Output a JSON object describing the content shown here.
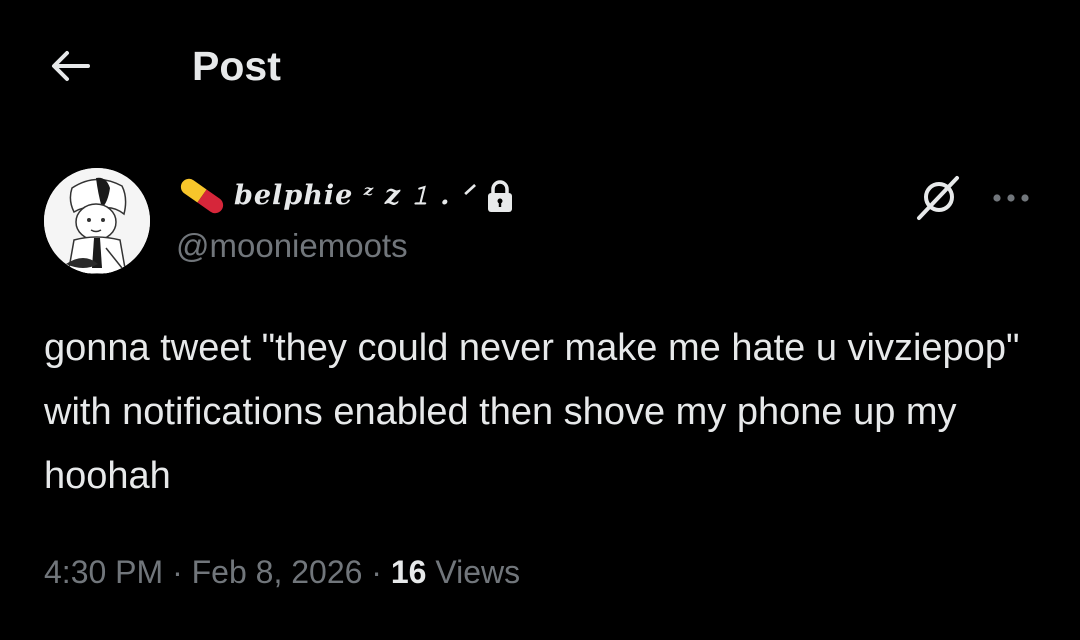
{
  "header": {
    "title": "Post",
    "back_icon": "arrow-left-icon"
  },
  "author": {
    "display_name": "belphie ᶻ z 𝟷 . ᐟ",
    "handle": "@mooniemoots",
    "avatar_icon": "avatar-image",
    "name_emoji": "pill-icon",
    "protected_icon": "lock-icon"
  },
  "actions": {
    "grok_icon": "grok-icon",
    "more_icon": "more-horizontal-icon"
  },
  "tweet": {
    "text": "gonna tweet \"they could never make me hate u vivziepop\" with notifications enabled then shove my phone up my hoohah",
    "time": "4:30 PM",
    "separator": "·",
    "date": "Feb 8, 2026",
    "views_count": "16",
    "views_label": "Views"
  },
  "colors": {
    "background": "#000000",
    "primary_text": "#e7e9ea",
    "secondary_text": "#71767b",
    "pill_yellow": "#f7c52b",
    "pill_red": "#d6263a"
  }
}
